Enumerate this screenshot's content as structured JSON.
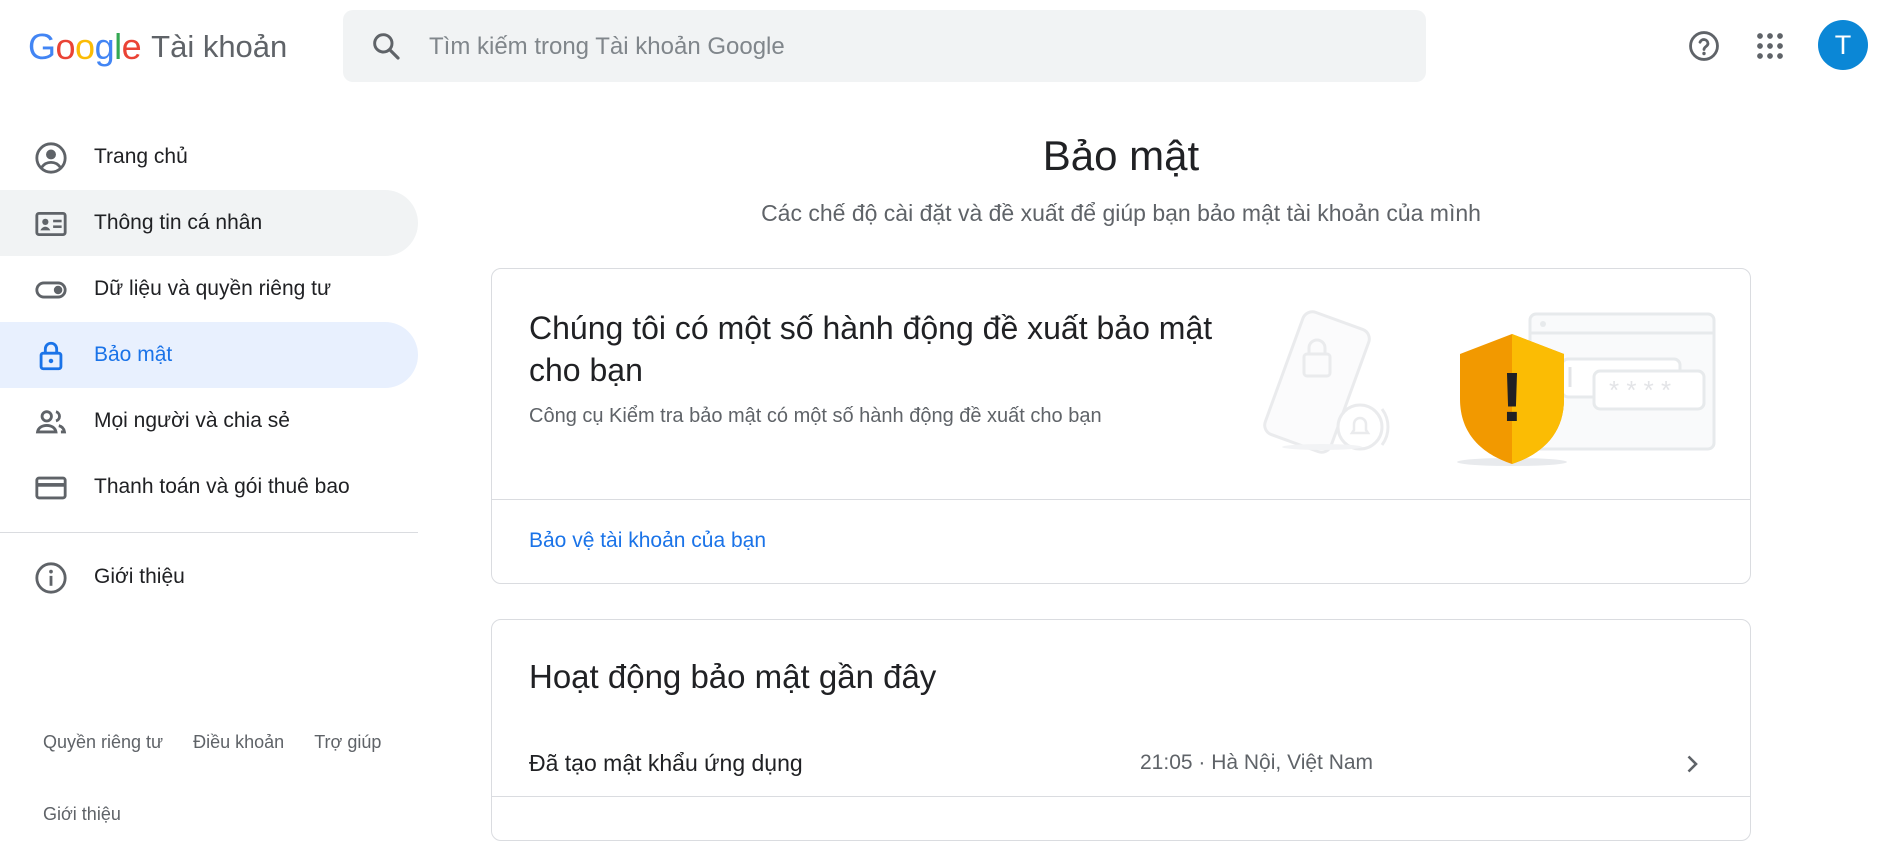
{
  "header": {
    "logo_text": "Google",
    "product": "Tài khoản",
    "search_placeholder": "Tìm kiếm trong Tài khoản Google",
    "avatar_letter": "T",
    "colors": {
      "blue": "#4285F4",
      "red": "#EA4335",
      "yellow": "#FBBC05",
      "green": "#34A853",
      "avatar": "#0b87d6"
    }
  },
  "sidebar": {
    "items": [
      {
        "label": "Trang chủ",
        "icon": "account-circle-icon"
      },
      {
        "label": "Thông tin cá nhân",
        "icon": "id-card-icon"
      },
      {
        "label": "Dữ liệu và quyền riêng tư",
        "icon": "toggle-icon"
      },
      {
        "label": "Bảo mật",
        "icon": "lock-icon"
      },
      {
        "label": "Mọi người và chia sẻ",
        "icon": "people-icon"
      },
      {
        "label": "Thanh toán và gói thuê bao",
        "icon": "credit-card-icon"
      },
      {
        "label": "Giới thiệu",
        "icon": "info-icon"
      }
    ],
    "footer": [
      "Quyền riêng tư",
      "Điều khoản",
      "Trợ giúp"
    ],
    "footer_extra": "Giới thiệu"
  },
  "main": {
    "title": "Bảo mật",
    "subtitle": "Các chế độ cài đặt và đề xuất để giúp bạn bảo mật tài khoản của mình",
    "recommend_card": {
      "title": "Chúng tôi có một số hành động đề xuất bảo mật cho bạn",
      "description": "Công cụ Kiểm tra bảo mật có một số hành động đề xuất cho bạn",
      "link": "Bảo vệ tài khoản của bạn",
      "illustration_password_mask": "* * * *",
      "illustration_mark": "!"
    },
    "activity_card": {
      "title": "Hoạt động bảo mật gần đây",
      "rows": [
        {
          "name": "Đã tạo mật khẩu ứng dụng",
          "meta": "21:05 · Hà Nội, Việt Nam"
        }
      ]
    }
  }
}
